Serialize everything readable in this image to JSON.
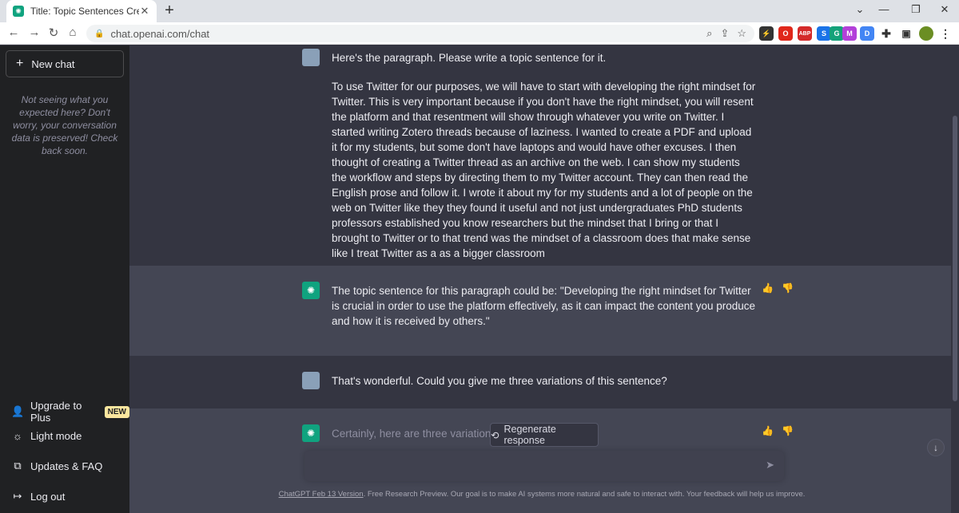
{
  "browser": {
    "tab_title": "Title: Topic Sentences Created.",
    "tab_close": "✕",
    "new_tab": "+",
    "url": "chat.openai.com/chat",
    "extensions": [
      {
        "name": "lightning-extension-icon",
        "label": "⚡",
        "color": "#333333"
      },
      {
        "name": "opera-extension-icon",
        "label": "O",
        "color": "#e0271a"
      },
      {
        "name": "adblock-extension-icon",
        "label": "ABP",
        "color": "#d42a2a"
      },
      {
        "name": "search-extension-icon",
        "label": "S",
        "color": "#1a73e8"
      },
      {
        "name": "grammar-extension-icon",
        "label": "G",
        "color": "#15a27a"
      },
      {
        "name": "library-extension-icon",
        "label": "M",
        "color": "#b240d9"
      },
      {
        "name": "docs-extension-icon",
        "label": "D",
        "color": "#4285f4"
      }
    ]
  },
  "sidebar": {
    "new_chat": "New chat",
    "note": "Not seeing what you expected here? Don't worry, your conversation data is preserved! Check back soon.",
    "upgrade": "Upgrade to Plus",
    "upgrade_badge": "NEW",
    "light_mode": "Light mode",
    "updates": "Updates & FAQ",
    "logout": "Log out"
  },
  "conversation": {
    "m1_intro": "Here's the paragraph. Please write a topic sentence for it.",
    "m1_body": "To use Twitter for our purposes, we will have to start with developing the right mindset for Twitter. This is very important because if you don't have the right mindset, you will resent the platform and that resentment will show through whatever you write on Twitter. I started writing Zotero threads because of laziness. I wanted to create a PDF and upload it for my students, but some don't have laptops and would have other excuses. I then thought of creating a Twitter thread as an archive on the web. I can show my students the workflow and steps by directing them to my Twitter account. They can then read the English prose and follow it. I wrote it about my for my students and a lot of people on the web on Twitter like they they found it useful and not just undergraduates PhD students professors established you know researchers but the mindset that I bring or that I brought to Twitter or to that trend was the mindset of a classroom does that make sense like I treat Twitter as a as a bigger classroom",
    "m2": "The topic sentence for this paragraph could be: \"Developing the right mindset for Twitter is crucial in order to use the platform effectively, as it can impact the content you produce and how it is received by others.\"",
    "m3": "That's wonderful. Could you give me three variations of this sentence?",
    "m4": "Certainly, here are three variations c"
  },
  "composer": {
    "regenerate": "Regenerate response",
    "placeholder": ""
  },
  "footer": {
    "link": "ChatGPT Feb 13 Version",
    "text": ". Free Research Preview. Our goal is to make AI systems more natural and safe to interact with. Your feedback will help us improve."
  }
}
